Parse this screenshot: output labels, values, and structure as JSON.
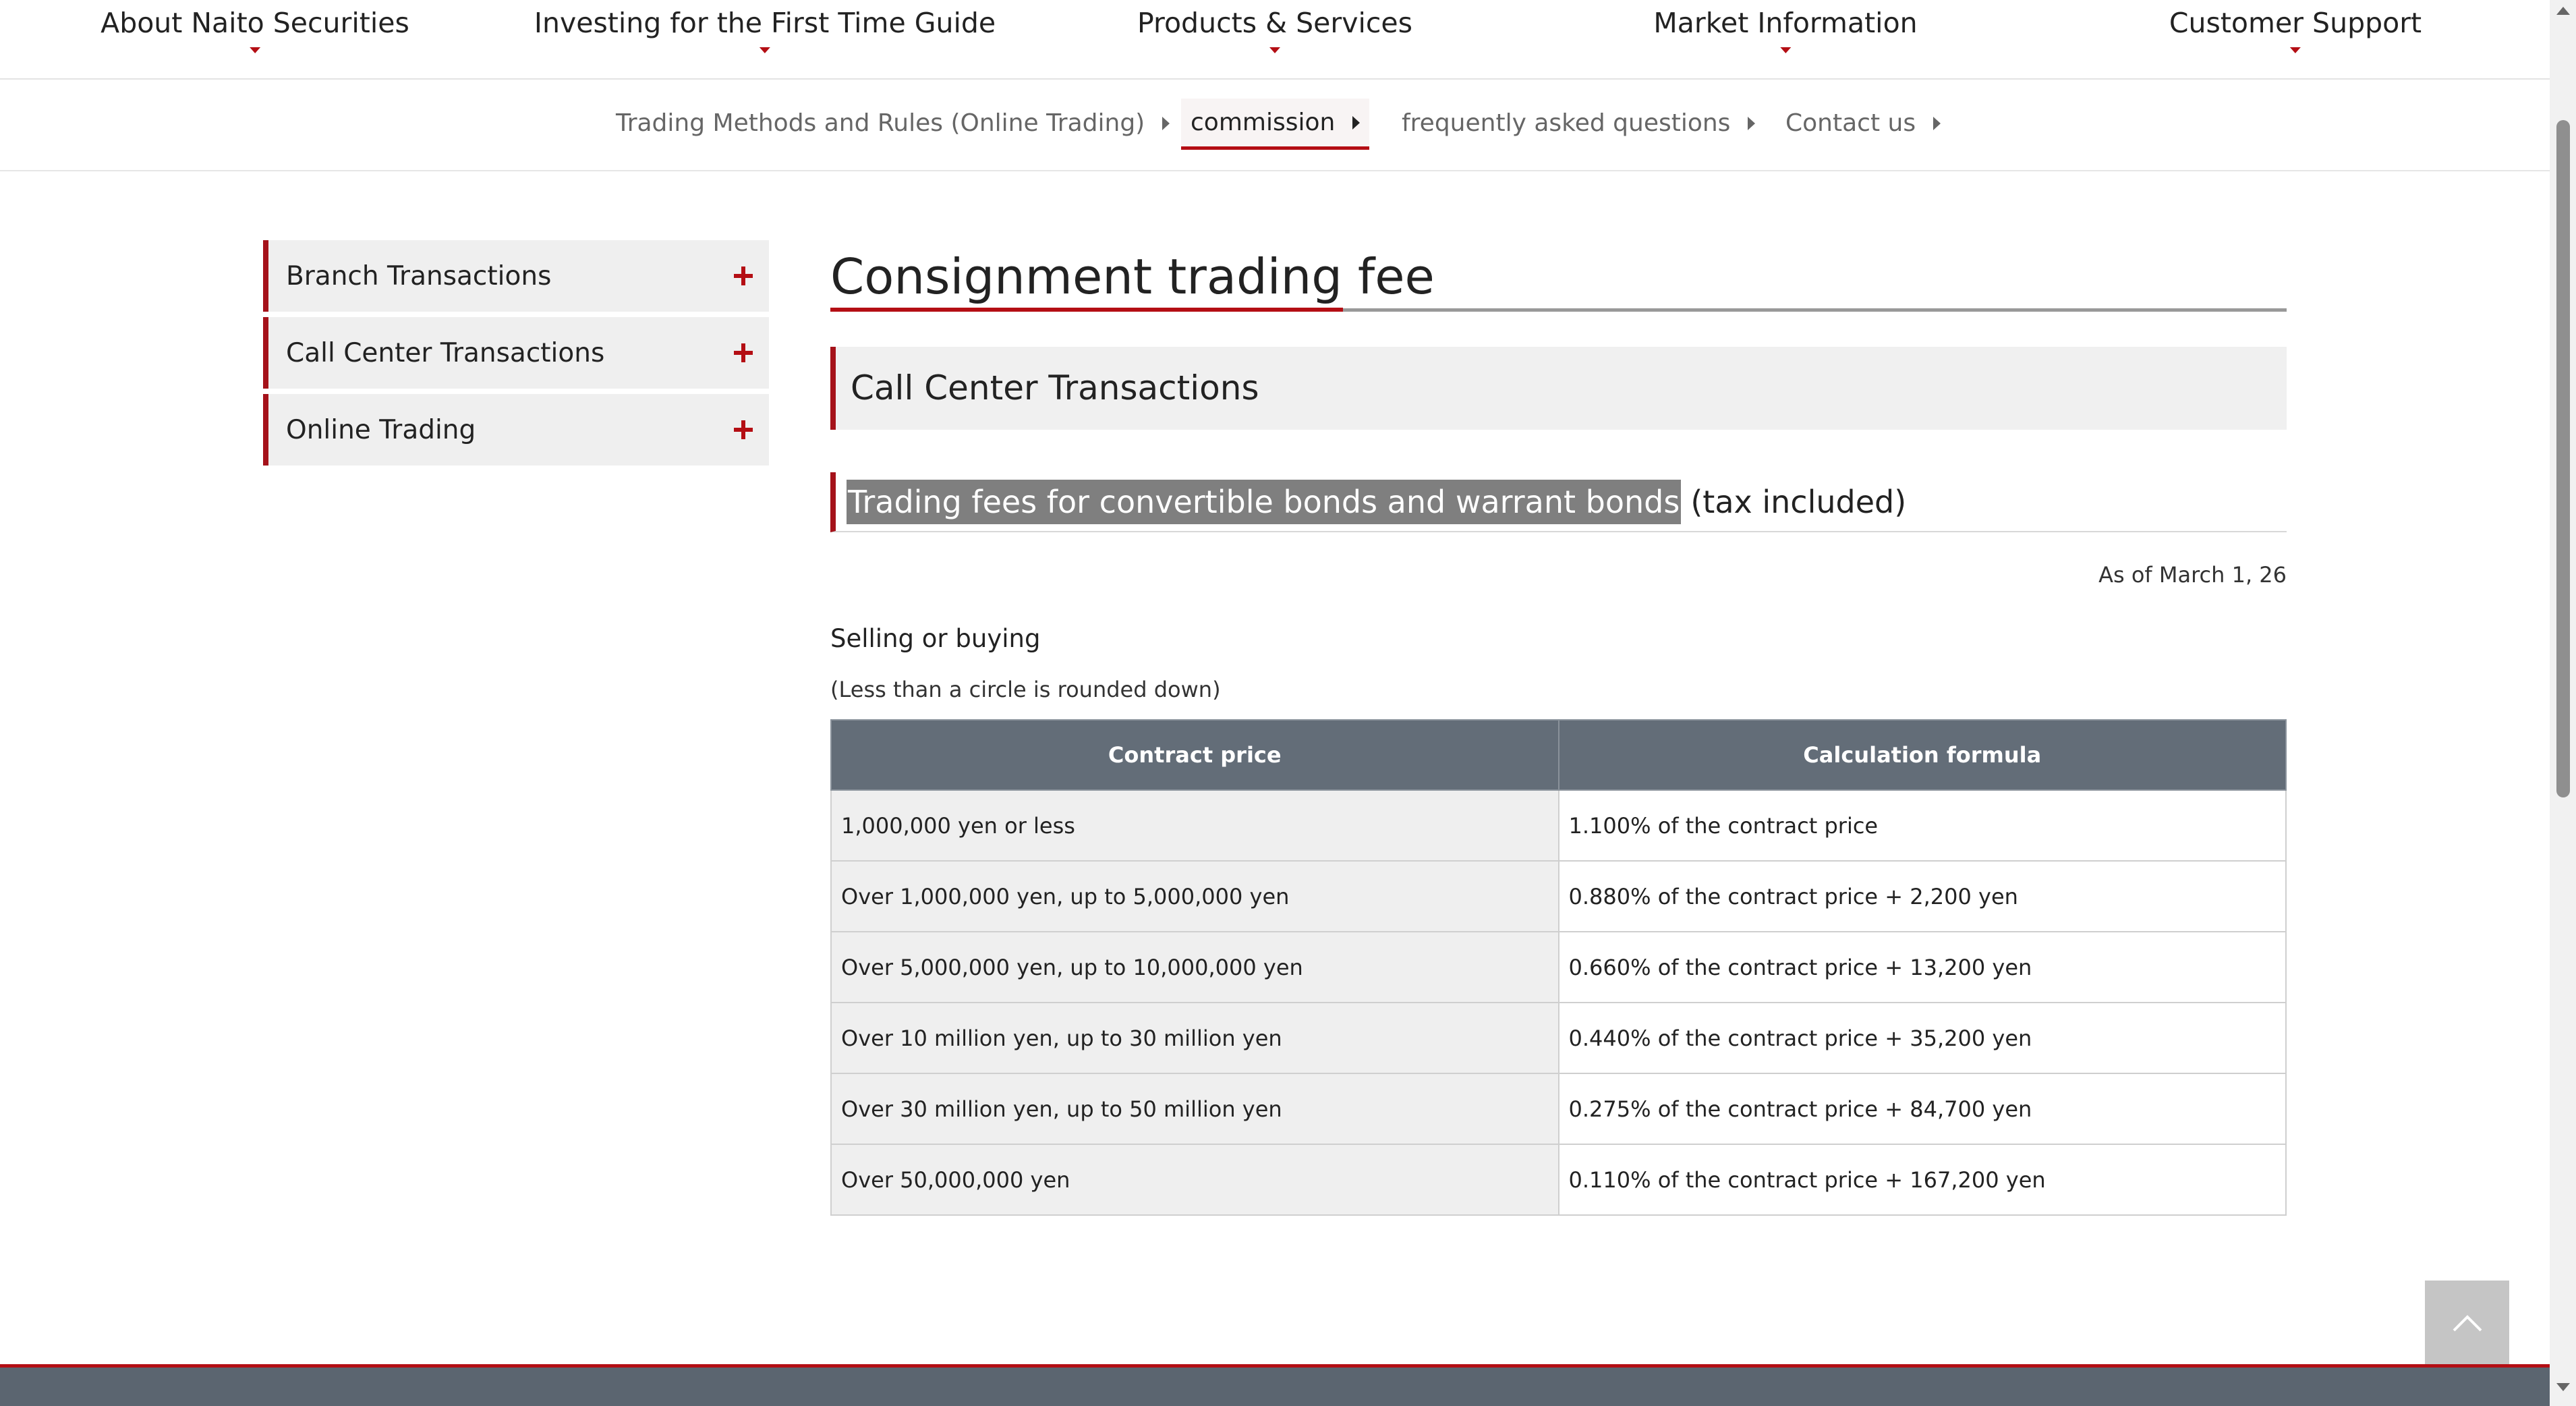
{
  "topnav": {
    "items": [
      {
        "label": "About Naito Securities"
      },
      {
        "label": "Investing for the First Time Guide"
      },
      {
        "label": "Products & Services"
      },
      {
        "label": "Market Information"
      },
      {
        "label": "Customer Support"
      }
    ]
  },
  "subnav": {
    "items": [
      {
        "label": "Trading Methods and Rules (Online Trading)"
      },
      {
        "label": "commission",
        "active": true
      },
      {
        "label": "frequently asked questions"
      },
      {
        "label": "Contact us"
      }
    ]
  },
  "sidebar": {
    "items": [
      {
        "label": "Branch Transactions"
      },
      {
        "label": "Call Center Transactions"
      },
      {
        "label": "Online Trading"
      }
    ]
  },
  "main": {
    "title": "Consignment trading fee",
    "section": "Call Center Transactions",
    "subsection_selected": "Trading fees for convertible bonds and warrant bonds",
    "subsection_rest": "(tax included)",
    "as_of": "As of March 1, 26",
    "selling_buying": "Selling or buying",
    "rounding_note": "(Less than a circle is rounded down)",
    "table": {
      "headers": [
        "Contract price",
        "Calculation formula"
      ],
      "rows": [
        [
          "1,000,000 yen or less",
          "1.100% of the contract price"
        ],
        [
          "Over 1,000,000 yen, up to 5,000,000 yen",
          "0.880% of the contract price + 2,200 yen"
        ],
        [
          "Over 5,000,000 yen, up to 10,000,000 yen",
          "0.660% of the contract price + 13,200 yen"
        ],
        [
          "Over 10 million yen, up to 30 million yen",
          "0.440% of the contract price + 35,200 yen"
        ],
        [
          "Over 30 million yen, up to 50 million yen",
          "0.275% of the contract price + 84,700 yen"
        ],
        [
          "Over 50,000,000 yen",
          "0.110% of the contract price + 167,200 yen"
        ]
      ]
    }
  },
  "colors": {
    "accent": "#b40e14",
    "table_header": "#636d78",
    "footer": "#5b6570"
  },
  "icons": {
    "expand": "plus-icon",
    "dropdown": "caret-down-icon",
    "subnav": "triangle-right-icon",
    "back_to_top": "chevron-up-icon"
  }
}
